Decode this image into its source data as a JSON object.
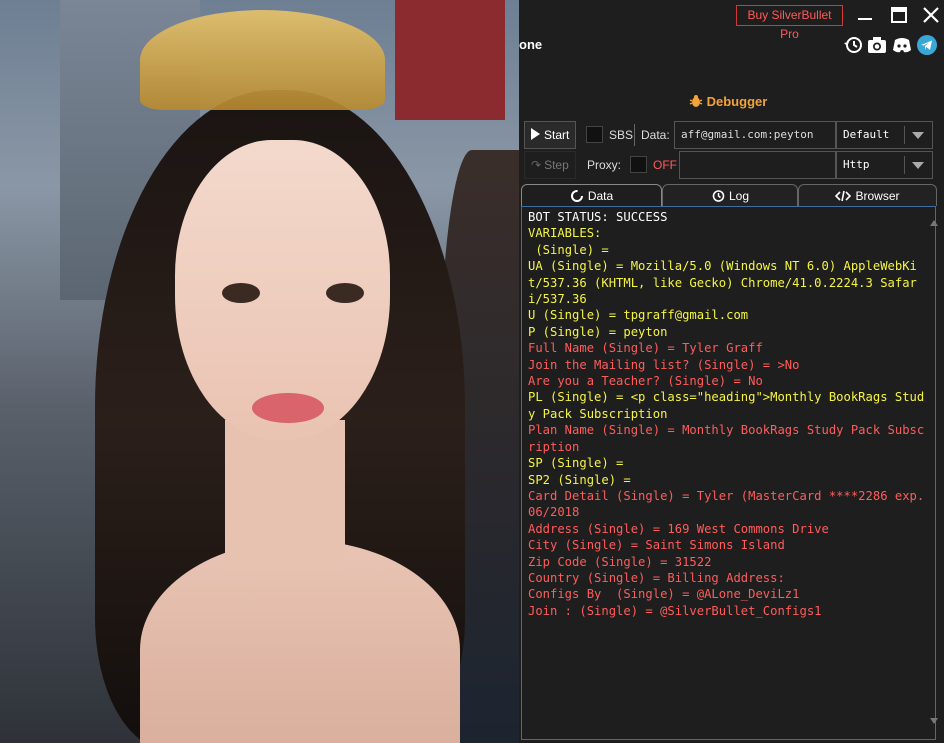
{
  "topbar": {
    "buy_label": "Buy SilverBullet Pro",
    "title_fragment": "one",
    "icons": [
      "history-icon",
      "camera-icon",
      "discord-icon",
      "telegram-icon"
    ]
  },
  "debugger": {
    "title": "Debugger",
    "icon": "bug-icon"
  },
  "controls": {
    "start_label": "Start",
    "sbs_label": "SBS",
    "data_label": "Data:",
    "data_value": "aff@gmail.com:peyton",
    "config_select": "Default",
    "step_label": "Step",
    "proxy_label": "Proxy:",
    "proxy_toggle": "OFF",
    "proxy_type": "Http"
  },
  "tabs": [
    {
      "label": "Data",
      "icon": "loading-icon"
    },
    {
      "label": "Log",
      "icon": "history-icon"
    },
    {
      "label": "Browser",
      "icon": "code-icon"
    }
  ],
  "output_lines": [
    {
      "text": "BOT STATUS: SUCCESS",
      "color": "white"
    },
    {
      "text": "VARIABLES:",
      "color": "yellow"
    },
    {
      "text": " (Single) =",
      "color": "yellow"
    },
    {
      "text": "UA (Single) = Mozilla/5.0 (Windows NT 6.0) AppleWebKit/537.36 (KHTML, like Gecko) Chrome/41.0.2224.3 Safari/537.36",
      "color": "yellow"
    },
    {
      "text": "U (Single) = tpgraff@gmail.com",
      "color": "yellow"
    },
    {
      "text": "P (Single) = peyton",
      "color": "yellow"
    },
    {
      "text": "Full Name (Single) = Tyler Graff",
      "color": "red"
    },
    {
      "text": "Join the Mailing list? (Single) = >No",
      "color": "red"
    },
    {
      "text": "Are you a Teacher? (Single) = No",
      "color": "red"
    },
    {
      "text": "PL (Single) = <p class=\"heading\">Monthly BookRags Study Pack Subscription",
      "color": "yellow"
    },
    {
      "text": "Plan Name (Single) = Monthly BookRags Study Pack Subscription",
      "color": "red"
    },
    {
      "text": "SP (Single) =",
      "color": "yellow"
    },
    {
      "text": "SP2 (Single) =",
      "color": "yellow"
    },
    {
      "text": "Card Detail (Single) = Tyler (MasterCard ****2286 exp. 06/2018",
      "color": "red"
    },
    {
      "text": "Address (Single) = 169 West Commons Drive",
      "color": "red"
    },
    {
      "text": "City (Single) = Saint Simons Island",
      "color": "red"
    },
    {
      "text": "Zip Code (Single) = 31522",
      "color": "red"
    },
    {
      "text": "Country (Single) = Billing Address:",
      "color": "red"
    },
    {
      "text": "Configs By  (Single) = @ALone_DeviLz1",
      "color": "red"
    },
    {
      "text": "Join : (Single) = @SilverBullet_Configs1",
      "color": "red"
    }
  ],
  "colors": {
    "white": "#ffffff",
    "yellow": "#f5f542",
    "red": "#ff5c5c",
    "accent": "#f2a33a"
  }
}
